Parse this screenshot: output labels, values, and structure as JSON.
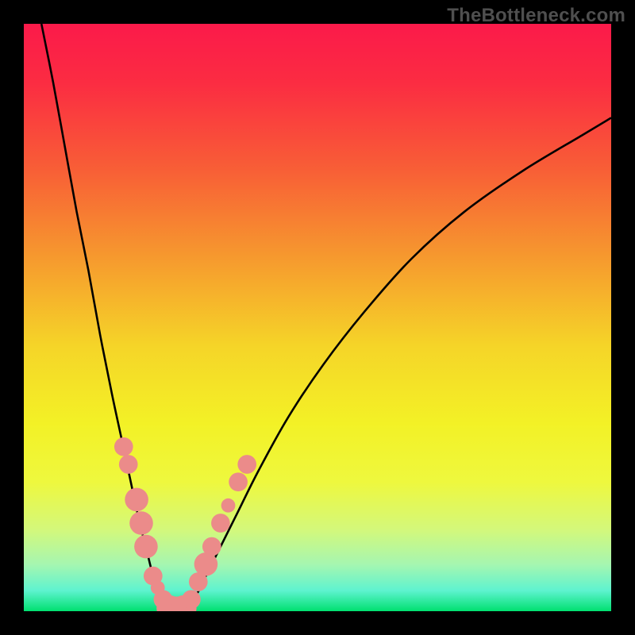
{
  "watermark": "TheBottleneck.com",
  "chart_data": {
    "type": "line",
    "title": "",
    "xlabel": "",
    "ylabel": "",
    "xlim": [
      0,
      100
    ],
    "ylim": [
      0,
      100
    ],
    "grid": false,
    "legend": false,
    "gradient_stops": [
      {
        "offset": 0.0,
        "color": "#fb1a4a"
      },
      {
        "offset": 0.1,
        "color": "#fb2c42"
      },
      {
        "offset": 0.25,
        "color": "#f85f36"
      },
      {
        "offset": 0.4,
        "color": "#f69a2e"
      },
      {
        "offset": 0.55,
        "color": "#f5d528"
      },
      {
        "offset": 0.68,
        "color": "#f3f126"
      },
      {
        "offset": 0.78,
        "color": "#eef83e"
      },
      {
        "offset": 0.86,
        "color": "#d4f87a"
      },
      {
        "offset": 0.92,
        "color": "#a6f6b0"
      },
      {
        "offset": 0.965,
        "color": "#5ef3cf"
      },
      {
        "offset": 1.0,
        "color": "#00e070"
      }
    ],
    "series": [
      {
        "name": "left-curve",
        "x": [
          3,
          5,
          7,
          9,
          11,
          13,
          15,
          16.5,
          18,
          19.5,
          21,
          22,
          23,
          24,
          25
        ],
        "y": [
          100,
          90,
          79,
          68,
          58,
          47,
          37,
          30,
          23,
          16,
          10,
          6,
          3,
          1,
          0
        ]
      },
      {
        "name": "right-curve",
        "x": [
          27,
          28,
          29.5,
          31,
          33,
          36,
          40,
          45,
          51,
          58,
          66,
          75,
          85,
          95,
          100
        ],
        "y": [
          0,
          1,
          3,
          6,
          10,
          16,
          24,
          33,
          42,
          51,
          60,
          68,
          75,
          81,
          84
        ]
      }
    ],
    "markers": {
      "name": "highlight-dots",
      "color": "#eb8b8a",
      "points": [
        {
          "x": 17.0,
          "y": 28,
          "r": 1.6
        },
        {
          "x": 17.8,
          "y": 25,
          "r": 1.6
        },
        {
          "x": 19.2,
          "y": 19,
          "r": 2.0
        },
        {
          "x": 20.0,
          "y": 15,
          "r": 2.0
        },
        {
          "x": 20.8,
          "y": 11,
          "r": 2.0
        },
        {
          "x": 22.0,
          "y": 6,
          "r": 1.6
        },
        {
          "x": 22.8,
          "y": 4,
          "r": 1.2
        },
        {
          "x": 23.7,
          "y": 2,
          "r": 1.6
        },
        {
          "x": 24.8,
          "y": 0.5,
          "r": 2.2
        },
        {
          "x": 26.0,
          "y": 0.3,
          "r": 2.2
        },
        {
          "x": 27.2,
          "y": 0.5,
          "r": 2.2
        },
        {
          "x": 28.5,
          "y": 2,
          "r": 1.6
        },
        {
          "x": 29.7,
          "y": 5,
          "r": 1.6
        },
        {
          "x": 31.0,
          "y": 8,
          "r": 2.0
        },
        {
          "x": 32.0,
          "y": 11,
          "r": 1.6
        },
        {
          "x": 33.5,
          "y": 15,
          "r": 1.6
        },
        {
          "x": 34.8,
          "y": 18,
          "r": 1.2
        },
        {
          "x": 36.5,
          "y": 22,
          "r": 1.6
        },
        {
          "x": 38.0,
          "y": 25,
          "r": 1.6
        }
      ]
    }
  }
}
